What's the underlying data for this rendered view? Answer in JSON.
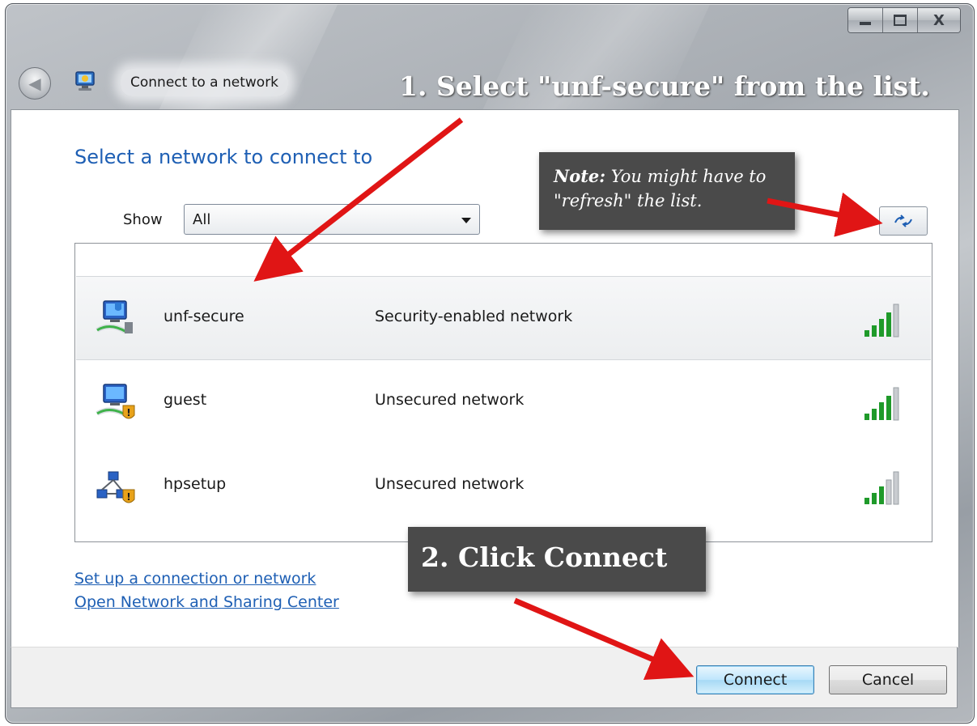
{
  "window": {
    "title": "Connect to a network",
    "caption_buttons": {
      "minimize": "–",
      "maximize": "□",
      "close": "X"
    },
    "back_glyph": "◀"
  },
  "annotations": {
    "step1": "1. Select \"unf-secure\" from the list.",
    "note_bold": "Note:",
    "note_rest": " You might have to \"refresh\" the list.",
    "step2": "2. Click Connect",
    "arrow_color": "#e01515"
  },
  "main": {
    "heading": "Select a network to connect to",
    "show_label": "Show",
    "filter_value": "All",
    "refresh_icon": "refresh-icon",
    "networks": [
      {
        "name": "unf-secure",
        "description": "Security-enabled network",
        "icon": "secured-network-icon",
        "signal": "signal-strength-icon",
        "selected": true
      },
      {
        "name": "guest",
        "description": "Unsecured network",
        "icon": "unsecured-network-icon",
        "signal": "signal-strength-icon",
        "selected": false
      },
      {
        "name": "hpsetup",
        "description": "Unsecured network",
        "icon": "adhoc-unsecured-network-icon",
        "signal": "signal-strength-icon",
        "selected": false
      }
    ],
    "links": {
      "setup": "Set up a connection or network",
      "sharing": "Open Network and Sharing Center"
    }
  },
  "footer": {
    "connect": "Connect",
    "cancel": "Cancel"
  },
  "colors": {
    "heading_blue": "#1e5fb4",
    "callout_bg": "#4a4a4a",
    "signal_green": "#1f9a2a"
  }
}
